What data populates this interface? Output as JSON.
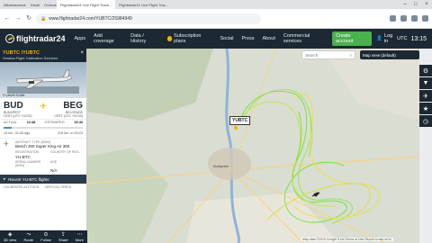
{
  "browser": {
    "bookmarks": [
      "Alkalmazások",
      "Gmail",
      "Outlook",
      "Fordítás",
      "Fanszerviz",
      "Források",
      "Címtár"
    ],
    "tabs": [
      {
        "label": "Flightradar24 Live Flight Track..."
      },
      {
        "label": "Flightradar24 Live Flight Trac..."
      }
    ],
    "url": "www.flightradar24.com/YUBTC/25984949"
  },
  "header": {
    "logo": "flightradar24",
    "nav": [
      "Apps",
      "Add coverage",
      "Data / History",
      "Subscription plans",
      "Social",
      "Press",
      "About",
      "Commercial services"
    ],
    "create_account": "Create account",
    "login": "Log in",
    "utc": "UTC",
    "time": "13:15"
  },
  "flight": {
    "callsign": "YUBTC /YUBTC",
    "operator": "Smatsa Flight Calibration Services",
    "photo_credit": "© László Kurilla",
    "from_code": "BUD",
    "from_city": "BUDAPEST",
    "from_tz": "CEST (UTC +02:00)",
    "to_code": "BEG",
    "to_city": "BELGRADE",
    "to_tz": "CEST (UTC +02:00)",
    "actual_label": "ACTUAL",
    "actual_time": "12:48",
    "estimated_label": "ESTIMATED",
    "estimated_time": "15:40",
    "progress": 0.1,
    "dist_left": "19 km, 02:28 ago",
    "dist_right": "319 km, in 00:23",
    "aircraft_type_label": "AIRCRAFT TYPE",
    "aircraft_type_code": "(B350)",
    "aircraft_type": "Beech 300 Super King Air 350",
    "registration_label": "REGISTRATION",
    "registration": "YU-BTC",
    "country_label": "COUNTRY OF REG.",
    "country": "",
    "serial_label": "SERIAL NUMBER (MSN)",
    "serial": "",
    "age_label": "AGE",
    "age": "N/A",
    "recent_label": "Recent YU-BTC flights",
    "calibrated_alt_label": "CALIBRATED ALTITUDE",
    "vertical_speed_label": "VERTICAL SPEED",
    "map_tag": "YUBTC"
  },
  "bottom_bar": [
    "3D view",
    "Route",
    "Follow",
    "Share",
    "More"
  ],
  "map": {
    "search_placeholder": "Search",
    "map_view": "Map view (default)",
    "city_label": "Budapest",
    "attribution": "Map data ©2019 Google   5 km   Terms of Use   Report a map error"
  },
  "colors": {
    "header_bg": "#1c2833",
    "accent": "#f5b300",
    "track_green": "#7ee04a",
    "track_yellow": "#e8e24a",
    "create_btn": "#4caf50"
  }
}
